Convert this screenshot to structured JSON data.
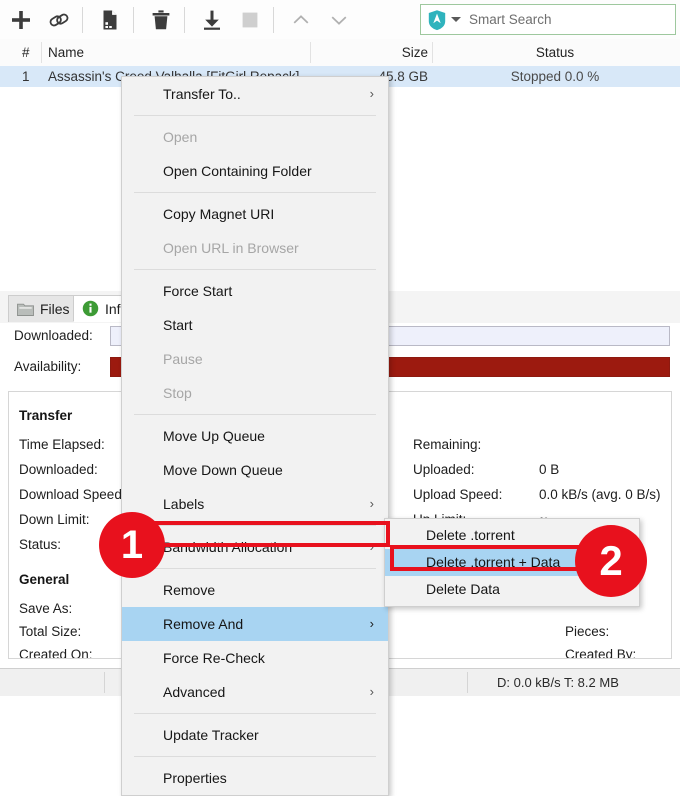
{
  "toolbar": {
    "buttons": [
      {
        "name": "add-torrent-button",
        "icon": "plus-icon",
        "label": "Add Torrent"
      },
      {
        "name": "add-link-button",
        "icon": "link-icon",
        "label": "Add Torrent Link"
      },
      {
        "name": "create-torrent-button",
        "icon": "new-file-icon",
        "label": "Create Torrent"
      },
      {
        "name": "remove-button",
        "icon": "trash-icon",
        "label": "Remove"
      },
      {
        "name": "start-button",
        "icon": "download-arrow-icon",
        "label": "Start"
      },
      {
        "name": "stop-button",
        "icon": "stop-square-icon",
        "label": "Stop"
      },
      {
        "name": "move-up-button",
        "icon": "chevron-up-icon",
        "label": "Move Up"
      },
      {
        "name": "move-down-button",
        "icon": "chevron-down-icon",
        "label": "Move Down"
      }
    ],
    "search": {
      "placeholder": "Smart Search",
      "icon": "shield-search-icon",
      "icon_color": "#2fb3bd",
      "border_color": "#9ec89e"
    }
  },
  "torrent_list": {
    "columns": [
      "#",
      "Name",
      "Size",
      "Status"
    ],
    "rows": [
      {
        "num": "1",
        "name": "Assassin's Creed Valhalla [FitGirl Repack]",
        "size": "45.8 GB",
        "status": "Stopped 0.0 %"
      }
    ]
  },
  "tabs": [
    {
      "label": "Files",
      "icon": "folder-icon",
      "state": "inactive"
    },
    {
      "label": "Info",
      "icon": "info-circle-icon",
      "state": "active"
    }
  ],
  "bars": [
    {
      "label": "Downloaded:",
      "fill_percent": 0,
      "color": "#eef0fb"
    },
    {
      "label": "Availability:",
      "fill_percent": 100,
      "color": "#9c1a0f"
    }
  ],
  "details": {
    "left_section_transfer": "Transfer",
    "left_rows": [
      {
        "label": "Time Elapsed:",
        "value": ""
      },
      {
        "label": "Downloaded:",
        "value": ""
      },
      {
        "label": "Download Speed:",
        "value": ""
      },
      {
        "label": "Down Limit:",
        "value": ""
      },
      {
        "label": "Status:",
        "value": ""
      }
    ],
    "left_section_general": "General",
    "general_rows": [
      {
        "label": "Save As:",
        "value": ""
      },
      {
        "label": "Total Size:",
        "value": ""
      },
      {
        "label": "Created On:",
        "value": ""
      }
    ],
    "right_rows": [
      {
        "label": "Remaining:",
        "value": ""
      },
      {
        "label": "Uploaded:",
        "value": "0 B"
      },
      {
        "label": "Upload Speed:",
        "value": "0.0 kB/s (avg. 0 B/s)"
      },
      {
        "label": "Up Limit:",
        "value": "∞"
      }
    ],
    "right_general_rows": [
      {
        "label": "Pieces:",
        "value": ""
      },
      {
        "label": "Created By:",
        "value": ""
      }
    ]
  },
  "context_menu": {
    "items": [
      {
        "label": "Transfer To..",
        "submenu": true,
        "disabled": false,
        "highlighted": false,
        "sep_after": true
      },
      {
        "label": "Open",
        "submenu": false,
        "disabled": true,
        "highlighted": false,
        "sep_after": false
      },
      {
        "label": "Open Containing Folder",
        "submenu": false,
        "disabled": false,
        "highlighted": false,
        "sep_after": true
      },
      {
        "label": "Copy Magnet URI",
        "submenu": false,
        "disabled": false,
        "highlighted": false,
        "sep_after": false
      },
      {
        "label": "Open URL in Browser",
        "submenu": false,
        "disabled": true,
        "highlighted": false,
        "sep_after": true
      },
      {
        "label": "Force Start",
        "submenu": false,
        "disabled": false,
        "highlighted": false,
        "sep_after": false
      },
      {
        "label": "Start",
        "submenu": false,
        "disabled": false,
        "highlighted": false,
        "sep_after": false
      },
      {
        "label": "Pause",
        "submenu": false,
        "disabled": true,
        "highlighted": false,
        "sep_after": false
      },
      {
        "label": "Stop",
        "submenu": false,
        "disabled": true,
        "highlighted": false,
        "sep_after": true
      },
      {
        "label": "Move Up Queue",
        "submenu": false,
        "disabled": false,
        "highlighted": false,
        "sep_after": false
      },
      {
        "label": "Move Down Queue",
        "submenu": false,
        "disabled": false,
        "highlighted": false,
        "sep_after": false
      },
      {
        "label": "Labels",
        "submenu": true,
        "disabled": false,
        "highlighted": false,
        "sep_after": true
      },
      {
        "label": "Bandwidth Allocation",
        "submenu": true,
        "disabled": false,
        "highlighted": false,
        "sep_after": true
      },
      {
        "label": "Remove",
        "submenu": false,
        "disabled": false,
        "highlighted": false,
        "sep_after": false
      },
      {
        "label": "Remove And",
        "submenu": true,
        "disabled": false,
        "highlighted": true,
        "sep_after": false
      },
      {
        "label": "Force Re-Check",
        "submenu": false,
        "disabled": false,
        "highlighted": false,
        "sep_after": false
      },
      {
        "label": "Advanced",
        "submenu": true,
        "disabled": false,
        "highlighted": false,
        "sep_after": true
      },
      {
        "label": "Update Tracker",
        "submenu": false,
        "disabled": false,
        "highlighted": false,
        "sep_after": true
      },
      {
        "label": "Properties",
        "submenu": false,
        "disabled": false,
        "highlighted": false,
        "sep_after": false
      }
    ]
  },
  "submenu": {
    "items": [
      {
        "label": "Delete .torrent",
        "highlighted": false
      },
      {
        "label": "Delete .torrent + Data",
        "highlighted": true
      },
      {
        "label": "Delete Data",
        "highlighted": false
      }
    ]
  },
  "annotations": {
    "color": "#e8111d",
    "badges": [
      {
        "number": "1",
        "target": "Remove And"
      },
      {
        "number": "2",
        "target": "Delete .torrent + Data"
      }
    ]
  },
  "statusbar": {
    "speed": "D: 0.0 kB/s T: 8.2 MB"
  }
}
